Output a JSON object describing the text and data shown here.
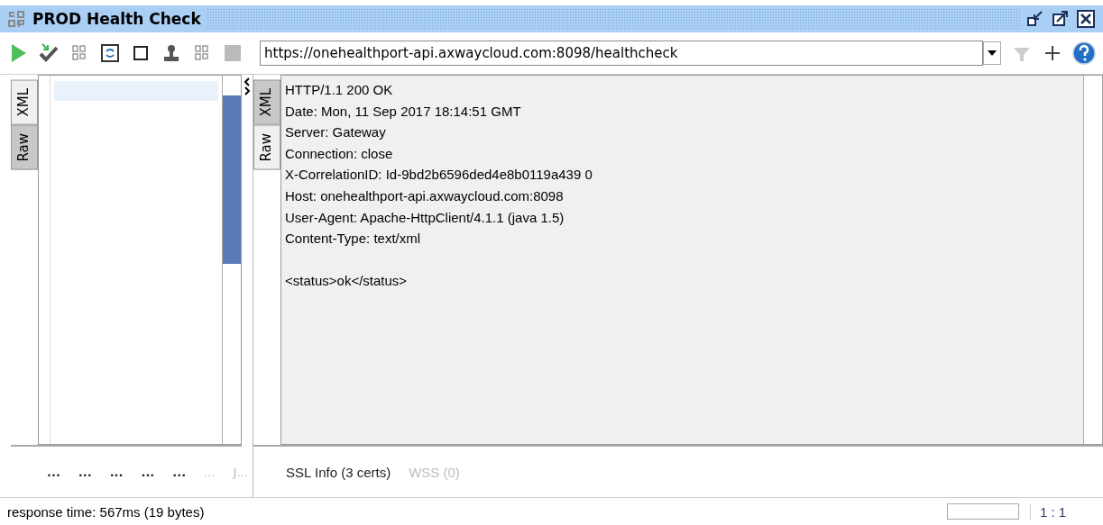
{
  "window": {
    "title": "PROD Health Check"
  },
  "toolbar": {
    "url": "https://onehealthport-api.axwaycloud.com:8098/healthcheck"
  },
  "request_pane": {
    "tabs": [
      {
        "label": "XML",
        "selected": true
      },
      {
        "label": "Raw",
        "selected": false
      }
    ],
    "bottom_tabs": [
      {
        "label": "...",
        "disabled": false
      },
      {
        "label": "...",
        "disabled": false
      },
      {
        "label": "...",
        "disabled": false
      },
      {
        "label": "...",
        "disabled": false
      },
      {
        "label": "...",
        "disabled": false
      },
      {
        "label": "...",
        "disabled": true
      },
      {
        "label": "J...",
        "disabled": true
      }
    ]
  },
  "response_pane": {
    "tabs": [
      {
        "label": "XML",
        "selected": false
      },
      {
        "label": "Raw",
        "selected": true
      }
    ],
    "headers": [
      "HTTP/1.1 200 OK",
      "Date: Mon, 11 Sep 2017 18:14:51 GMT",
      "Server: Gateway",
      "Connection: close",
      "X-CorrelationID: Id-9bd2b6596ded4e8b0119a439 0",
      "Host: onehealthport-api.axwaycloud.com:8098",
      "User-Agent: Apache-HttpClient/4.1.1 (java 1.5)",
      "Content-Type: text/xml"
    ],
    "body": "<status>ok</status>",
    "bottom_tabs": [
      {
        "label": "SSL Info (3 certs)",
        "disabled": false
      },
      {
        "label": "WSS (0)",
        "disabled": true
      }
    ]
  },
  "status_bar": {
    "message": "response time: 567ms (19 bytes)",
    "position": "1 : 1"
  }
}
